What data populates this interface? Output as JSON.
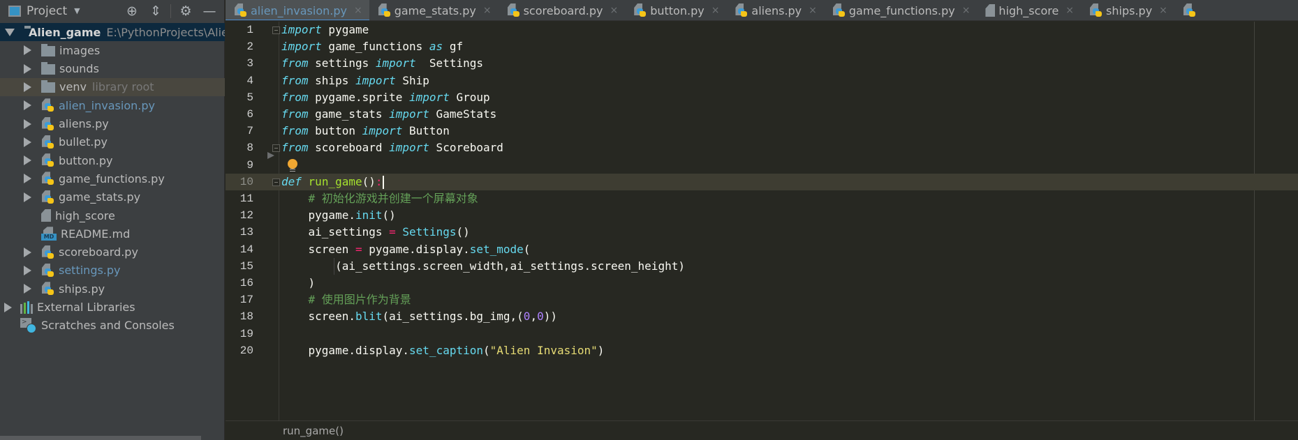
{
  "sidebar": {
    "title": "Project",
    "tools": {
      "locate": "crosshair-icon",
      "collapse": "collapse-all-icon",
      "settings": "gear-icon",
      "hide": "minimize-icon"
    },
    "root": {
      "name": "Alien_game",
      "path": "E:\\PythonProjects\\Alien_g"
    },
    "items": [
      {
        "label": "images",
        "type": "folder"
      },
      {
        "label": "sounds",
        "type": "folder"
      },
      {
        "label": "venv",
        "type": "folder",
        "hint": "library root"
      },
      {
        "label": "alien_invasion.py",
        "type": "python",
        "modified": true
      },
      {
        "label": "aliens.py",
        "type": "python"
      },
      {
        "label": "bullet.py",
        "type": "python"
      },
      {
        "label": "button.py",
        "type": "python"
      },
      {
        "label": "game_functions.py",
        "type": "python"
      },
      {
        "label": "game_stats.py",
        "type": "python"
      },
      {
        "label": "high_score",
        "type": "text"
      },
      {
        "label": "README.md",
        "type": "markdown"
      },
      {
        "label": "scoreboard.py",
        "type": "python"
      },
      {
        "label": "settings.py",
        "type": "python",
        "modified": true
      },
      {
        "label": "ships.py",
        "type": "python"
      }
    ],
    "external_libraries": "External Libraries",
    "scratches": "Scratches and Consoles"
  },
  "tabs": [
    {
      "label": "alien_invasion.py",
      "type": "python",
      "active": true
    },
    {
      "label": "game_stats.py",
      "type": "python"
    },
    {
      "label": "scoreboard.py",
      "type": "python"
    },
    {
      "label": "button.py",
      "type": "python"
    },
    {
      "label": "aliens.py",
      "type": "python"
    },
    {
      "label": "game_functions.py",
      "type": "python"
    },
    {
      "label": "high_score",
      "type": "text"
    },
    {
      "label": "ships.py",
      "type": "python"
    }
  ],
  "tab_close_glyph": "×",
  "editor": {
    "current_line": 10,
    "lines": [
      {
        "n": "1",
        "tokens": [
          [
            "kw",
            "import"
          ],
          [
            "t",
            " pygame"
          ]
        ]
      },
      {
        "n": "2",
        "tokens": [
          [
            "kw",
            "import"
          ],
          [
            "t",
            " game_functions "
          ],
          [
            "kw",
            "as"
          ],
          [
            "t",
            " gf"
          ]
        ]
      },
      {
        "n": "3",
        "tokens": [
          [
            "kw",
            "from"
          ],
          [
            "t",
            " settings "
          ],
          [
            "kw",
            "import"
          ],
          [
            "t",
            "  Settings"
          ]
        ]
      },
      {
        "n": "4",
        "tokens": [
          [
            "kw",
            "from"
          ],
          [
            "t",
            " ships "
          ],
          [
            "kw",
            "import"
          ],
          [
            "t",
            " Ship"
          ]
        ]
      },
      {
        "n": "5",
        "tokens": [
          [
            "kw",
            "from"
          ],
          [
            "t",
            " pygame.sprite "
          ],
          [
            "kw",
            "import"
          ],
          [
            "t",
            " Group"
          ]
        ]
      },
      {
        "n": "6",
        "tokens": [
          [
            "kw",
            "from"
          ],
          [
            "t",
            " game_stats "
          ],
          [
            "kw",
            "import"
          ],
          [
            "t",
            " GameStats"
          ]
        ]
      },
      {
        "n": "7",
        "tokens": [
          [
            "kw",
            "from"
          ],
          [
            "t",
            " button "
          ],
          [
            "kw",
            "import"
          ],
          [
            "t",
            " Button"
          ]
        ]
      },
      {
        "n": "8",
        "tokens": [
          [
            "kw",
            "from"
          ],
          [
            "t",
            " scoreboard "
          ],
          [
            "kw",
            "import"
          ],
          [
            "t",
            " Scoreboard"
          ]
        ]
      },
      {
        "n": "9",
        "tokens": []
      },
      {
        "n": "10",
        "tokens": [
          [
            "kw",
            "def"
          ],
          [
            "t",
            " "
          ],
          [
            "fn",
            "run_game"
          ],
          [
            "t",
            "()"
          ],
          [
            "op",
            ":"
          ]
        ]
      },
      {
        "n": "11",
        "tokens": [
          [
            "t",
            "    "
          ],
          [
            "cm-cn",
            "# 初始化游戏并创建一个屏幕对象"
          ]
        ]
      },
      {
        "n": "12",
        "tokens": [
          [
            "t",
            "    pygame."
          ],
          [
            "call",
            "init"
          ],
          [
            "t",
            "()"
          ]
        ]
      },
      {
        "n": "13",
        "tokens": [
          [
            "t",
            "    ai_settings "
          ],
          [
            "op",
            "="
          ],
          [
            "t",
            " "
          ],
          [
            "call",
            "Settings"
          ],
          [
            "t",
            "()"
          ]
        ]
      },
      {
        "n": "14",
        "tokens": [
          [
            "t",
            "    screen "
          ],
          [
            "op",
            "="
          ],
          [
            "t",
            " pygame.display."
          ],
          [
            "call",
            "set_mode"
          ],
          [
            "t",
            "("
          ]
        ]
      },
      {
        "n": "15",
        "tokens": [
          [
            "t",
            "        (ai_settings.screen_width,ai_settings.screen_height)"
          ]
        ]
      },
      {
        "n": "16",
        "tokens": [
          [
            "t",
            "    )"
          ]
        ]
      },
      {
        "n": "17",
        "tokens": [
          [
            "t",
            "    "
          ],
          [
            "cm-cn",
            "# 使用图片作为背景"
          ]
        ]
      },
      {
        "n": "18",
        "tokens": [
          [
            "t",
            "    screen."
          ],
          [
            "call",
            "blit"
          ],
          [
            "t",
            "(ai_settings.bg_img,("
          ],
          [
            "num",
            "0"
          ],
          [
            "t",
            ","
          ],
          [
            "num",
            "0"
          ],
          [
            "t",
            "))"
          ]
        ]
      },
      {
        "n": "19",
        "tokens": []
      },
      {
        "n": "20",
        "tokens": [
          [
            "t",
            "    pygame.display."
          ],
          [
            "call",
            "set_caption"
          ],
          [
            "t",
            "("
          ],
          [
            "str",
            "\"Alien Invasion\""
          ],
          [
            "t",
            ")"
          ]
        ]
      }
    ]
  },
  "breadcrumb": "run_game()"
}
